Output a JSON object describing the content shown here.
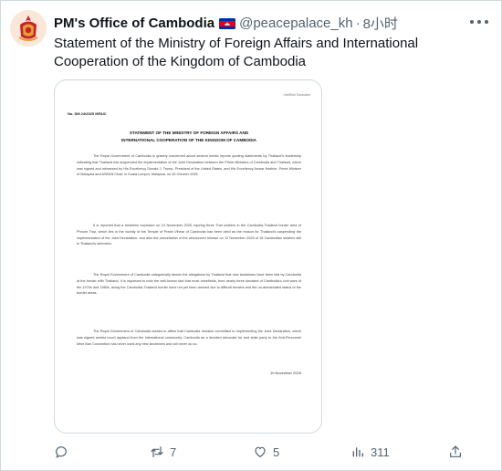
{
  "author": {
    "name": "PM's Office of Cambodia",
    "handle": "@peacepalace_kh",
    "separator": "·",
    "time": "8小时"
  },
  "tweet": {
    "text": "Statement of the Ministry of Foreign Affairs and International Cooperation of the Kingdom of Cambodia"
  },
  "document": {
    "unofficial": "Unofficial Translation",
    "reference": "No. SM 24/2025 MFAIC",
    "title_line1": "STATEMENT OF THE MINISTRY OF FOREIGN AFFAIRS AND",
    "title_line2": "INTERNATIONAL COOPERATION OF THE KINGDOM OF CAMBODIA",
    "paragraphs": [
      "The Royal Government of Cambodia is gravely concerned about several media reports quoting statements by Thailand's leadership indicating that Thailand has suspended the implementation of the Joint Declaration between the Prime Ministers of Cambodia and Thailand, which was signed and witnessed by His Excellency Donald J. Trump, President of the United States, and His Excellency Anwar Ibrahim, Prime Minister of Malaysia and ASEAN Chair, in Kuala Lumpur, Malaysia, on 26 October 2025.",
      "It is reported that a landmine explosion on 10 November 2025, injuring three Thai soldiers in the Cambodia-Thailand border area of Phnom Trop, which lies in the vicinity of the Temple of Preah Vihear of Cambodia has been cited as the reason for Thailand's suspending the implementation of the Joint Declaration, and also the cancellation of the announced release on 12 November 2025 of 18 Cambodian soldiers still in Thailand's detention.",
      "The Royal Government of Cambodia categorically denies the allegations by Thailand that new landmines have been laid by Cambodia at the border with Thailand. It is important to note the well-known fact that most minefields, from nearly three decades of Cambodia's civil wars of the 1970s and 1980s, along the Cambodia-Thailand border have not yet been cleared due to difficult terrains and the un-demarcated status of the border areas.",
      "The Royal Government of Cambodia wishes to affirm that Cambodia remains committed to implementing the Joint Declaration, which was signed amidst much applaud from the international community. Cambodia as a devoted advocate for and state party to the Anti-Personnel Mine Ban Convention has never used any new landmines and will never do so."
    ],
    "date": "10 November 2025"
  },
  "actions": {
    "reply": {
      "icon": "reply-icon",
      "count": ""
    },
    "retweet": {
      "icon": "retweet-icon",
      "count": "7"
    },
    "like": {
      "icon": "heart-icon",
      "count": "5"
    },
    "views": {
      "icon": "views-icon",
      "count": "311"
    },
    "share": {
      "icon": "share-icon",
      "count": ""
    }
  },
  "colors": {
    "text": "#0f1419",
    "secondary": "#536471",
    "border": "#cfd9de",
    "flag_blue": "#032ea1",
    "flag_red": "#e00025"
  }
}
